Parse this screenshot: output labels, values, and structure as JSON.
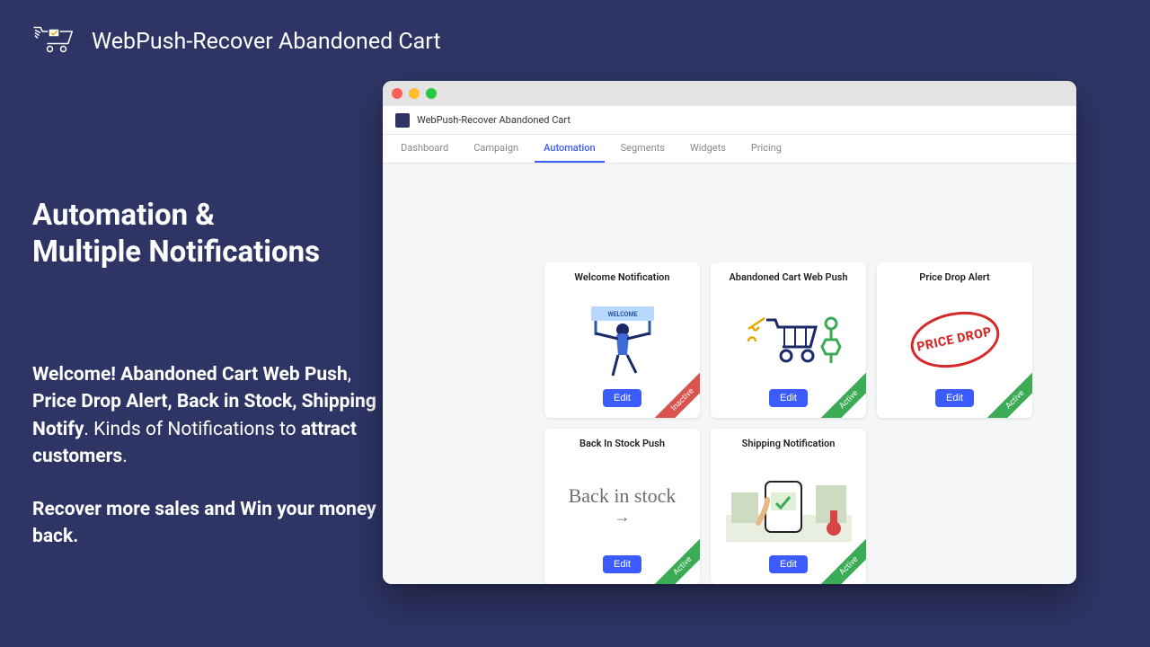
{
  "brand": {
    "app_name": "WebPush-Recover Abandoned Cart"
  },
  "promo": {
    "headline": "Automation &\nMultiple Notifications",
    "body_bold_prefix": "Welcome! Abandoned Cart Web Push",
    "body_sep1": ", ",
    "body_bold_mid": "Price Drop Alert, Back in Stock, Shipping Notify",
    "body_mid_plain": ". Kinds of Notifications to ",
    "body_bold_tail": "attract customers",
    "body_tail_plain": ".",
    "body2": "Recover more sales and Win your money back."
  },
  "window": {
    "app_title": "WebPush-Recover Abandoned Cart",
    "tabs": [
      "Dashboard",
      "Campaign",
      "Automation",
      "Segments",
      "Widgets",
      "Pricing"
    ],
    "active_tab_index": 2,
    "edit_label": "Edit",
    "status": {
      "active": "Active",
      "inactive": "Inactive"
    },
    "cards": [
      {
        "title": "Welcome Notification",
        "status": "inactive",
        "art": "welcome"
      },
      {
        "title": "Abandoned Cart Web Push",
        "status": "active",
        "art": "cart"
      },
      {
        "title": "Price Drop Alert",
        "status": "active",
        "art": "pricedrop"
      },
      {
        "title": "Back In Stock Push",
        "status": "active",
        "art": "backinstock"
      },
      {
        "title": "Shipping Notification",
        "status": "active",
        "art": "shipping"
      }
    ]
  },
  "colors": {
    "accent": "#3b5bff",
    "green": "#3bab56",
    "red": "#d9534f"
  }
}
